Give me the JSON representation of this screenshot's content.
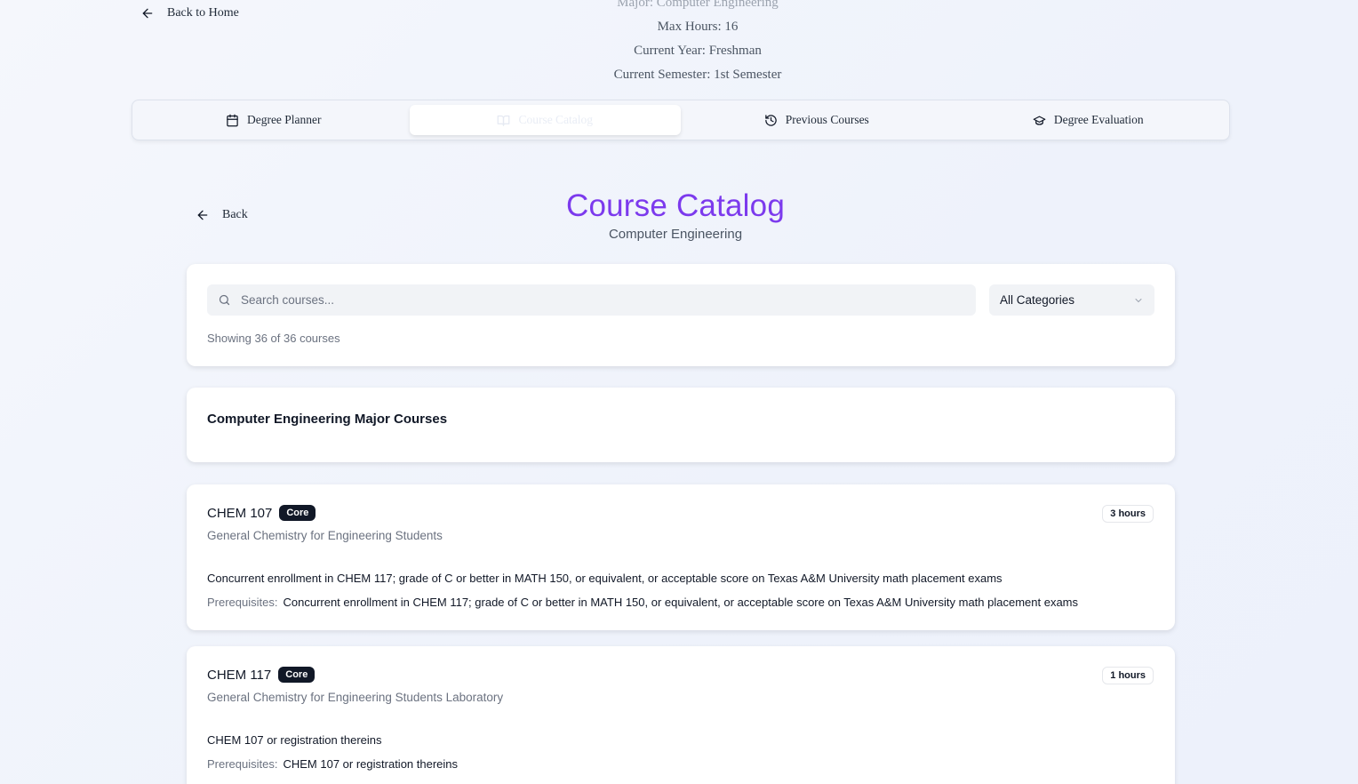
{
  "header": {
    "back_home_label": "Back to Home",
    "info_clipped": "Major: Computer Engineering",
    "max_hours": "Max Hours: 16",
    "current_year": "Current Year: Freshman",
    "current_semester": "Current Semester: 1st Semester"
  },
  "tabs": [
    {
      "label": "Degree Planner",
      "icon": "calendar-icon",
      "active": false
    },
    {
      "label": "Course Catalog",
      "icon": "book-open-icon",
      "active": true
    },
    {
      "label": "Previous Courses",
      "icon": "history-icon",
      "active": false
    },
    {
      "label": "Degree Evaluation",
      "icon": "graduation-cap-icon",
      "active": false
    }
  ],
  "catalog": {
    "back_label": "Back",
    "title": "Course Catalog",
    "subtitle": "Computer Engineering",
    "search_placeholder": "Search courses...",
    "category_selected": "All Categories",
    "showing_text": "Showing 36 of 36 courses",
    "section_title": "Computer Engineering Major Courses",
    "prereq_label": "Prerequisites:",
    "accent_color": "#7c3aed"
  },
  "courses": [
    {
      "code": "CHEM 107",
      "badge": "Core",
      "hours": "3 hours",
      "name": "General Chemistry for Engineering Students",
      "description": "Concurrent enrollment in CHEM 117; grade of C or better in MATH 150, or equivalent, or acceptable score on Texas A&M University math placement exams",
      "prerequisites": "Concurrent enrollment in CHEM 117; grade of C or better in MATH 150, or equivalent, or acceptable score on Texas A&M University math placement exams"
    },
    {
      "code": "CHEM 117",
      "badge": "Core",
      "hours": "1 hours",
      "name": "General Chemistry for Engineering Students Laboratory",
      "description": "CHEM 107 or registration thereins",
      "prerequisites": "CHEM 107 or registration thereins"
    }
  ]
}
